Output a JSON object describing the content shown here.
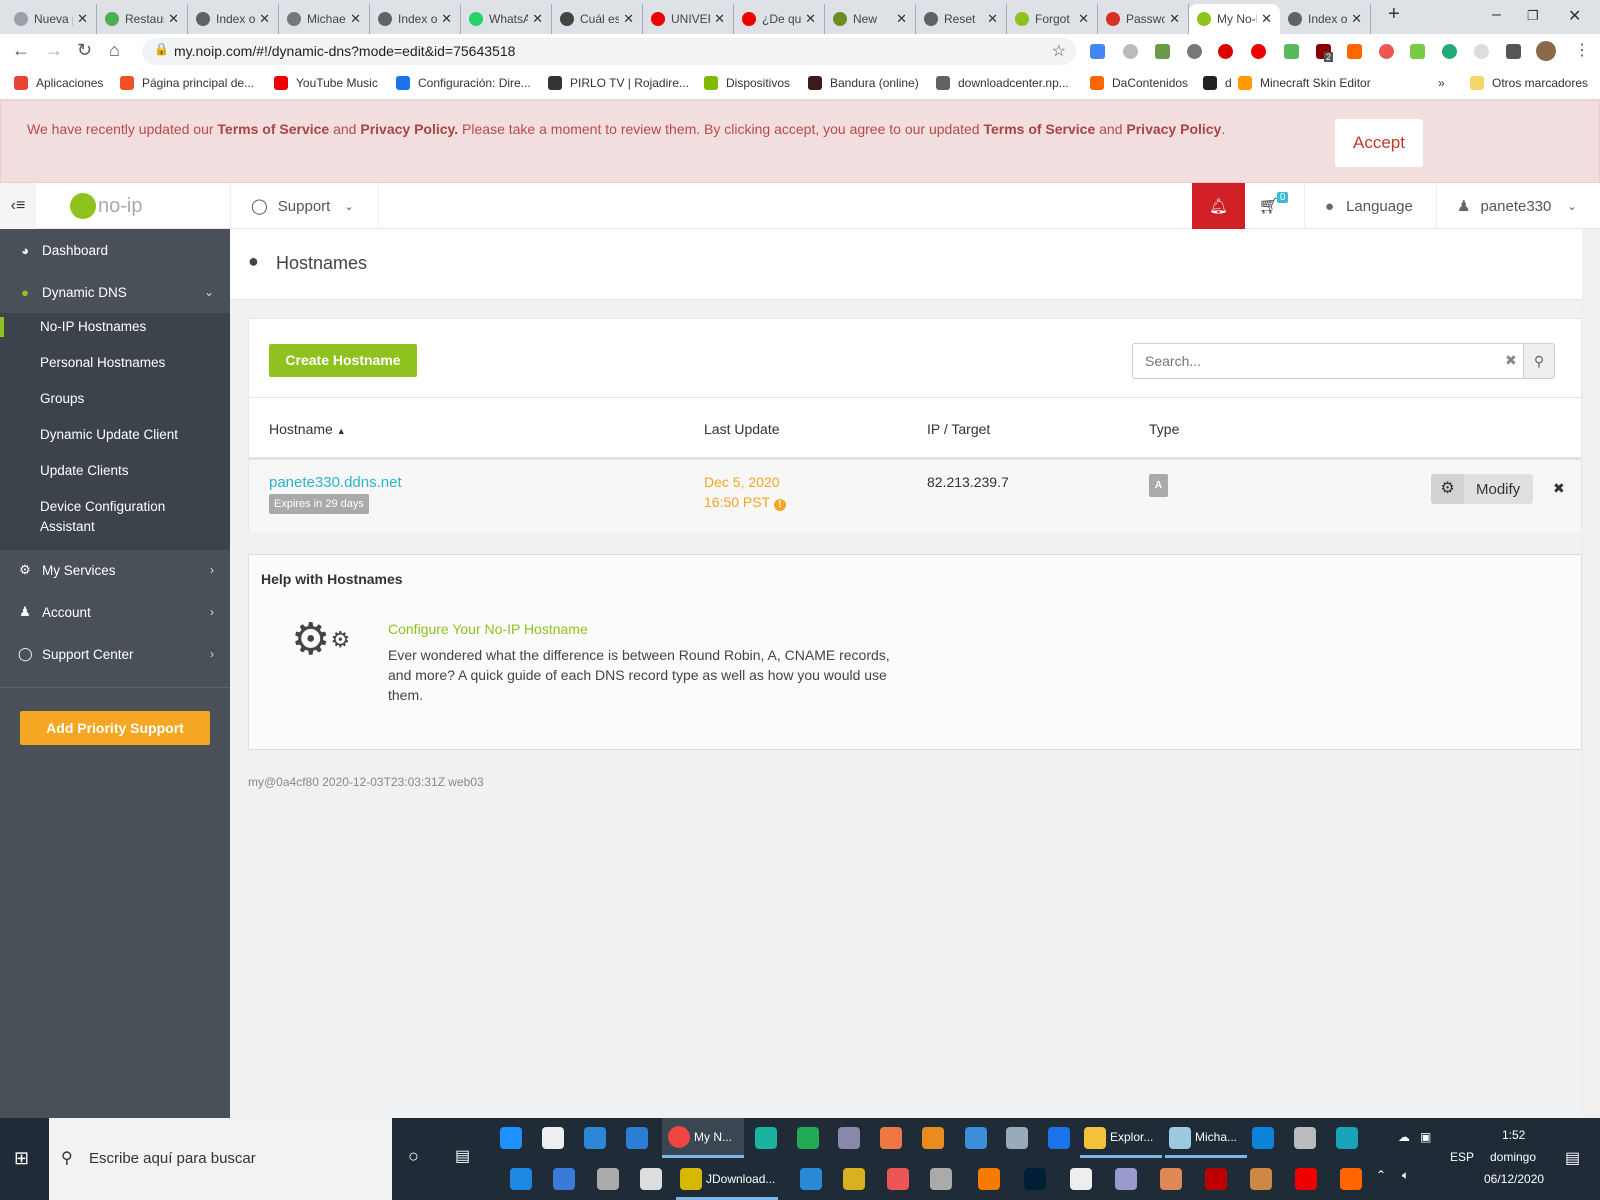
{
  "browser": {
    "tabs": [
      {
        "title": "Nueva pestaña",
        "color": "#9aa0a6"
      },
      {
        "title": "Restaurar",
        "color": "#4caf50"
      },
      {
        "title": "Index of",
        "color": "#5f6368"
      },
      {
        "title": "Michael",
        "color": "#777"
      },
      {
        "title": "Index of",
        "color": "#5f6368"
      },
      {
        "title": "WhatsApp",
        "color": "#25d366"
      },
      {
        "title": "Cuál es mi IP",
        "color": "#444"
      },
      {
        "title": "UNIVERSO",
        "color": "#e00"
      },
      {
        "title": "¿De qué",
        "color": "#e00"
      },
      {
        "title": "New",
        "color": "#6b8e23"
      },
      {
        "title": "Reset",
        "color": "#5f6368"
      },
      {
        "title": "Forgot",
        "color": "#8dc21f"
      },
      {
        "title": "Password",
        "color": "#d93025"
      },
      {
        "title": "My No-IP",
        "color": "#8dc21f"
      },
      {
        "title": "Index of",
        "color": "#5f6368"
      }
    ],
    "active_tab": 13,
    "url": "my.noip.com/#!/dynamic-dns?mode=edit&id=75643518",
    "bookmarks": [
      "Aplicaciones",
      "Página principal de...",
      "YouTube Music",
      "Configuración: Dire...",
      "PIRLO TV | Rojadire...",
      "Dispositivos",
      "Bandura (online)",
      "downloadcenter.np...",
      "DaContenidos",
      "d",
      "Minecraft Skin Editor"
    ],
    "other_bookmarks": "Otros marcadores",
    "ext_badge": "2"
  },
  "banner": {
    "t1": "We have recently updated our ",
    "l1": "Terms of Service",
    "t2": " and ",
    "l2": "Privacy Policy.",
    "t3": " Please take a moment to review them. By clicking accept, you agree to our updated ",
    "l3": "Terms of Service",
    "t4": " and ",
    "l4": "Privacy Policy",
    "t5": ".",
    "accept": "Accept"
  },
  "header": {
    "logo": "no-ip",
    "support": "Support",
    "cart_count": "0",
    "language": "Language",
    "user": "panete330"
  },
  "sidebar": {
    "dashboard": "Dashboard",
    "dynamic_dns": "Dynamic DNS",
    "sub": [
      "No-IP Hostnames",
      "Personal Hostnames",
      "Groups",
      "Dynamic Update Client",
      "Update Clients",
      "Device Configuration Assistant"
    ],
    "my_services": "My Services",
    "account": "Account",
    "support_center": "Support Center",
    "priority": "Add Priority Support"
  },
  "page": {
    "title": "Hostnames"
  },
  "panel": {
    "create": "Create Hostname",
    "search_placeholder": "Search...",
    "columns": [
      "Hostname",
      "Last Update",
      "IP / Target",
      "Type"
    ],
    "row": {
      "hostname": "panete330.ddns.net",
      "expires": "Expires in 29 days",
      "date": "Dec 5, 2020",
      "time": "16:50 PST",
      "ip": "82.213.239.7",
      "type": "A",
      "modify": "Modify"
    }
  },
  "help": {
    "heading": "Help with Hostnames",
    "link": "Configure Your No-IP Hostname",
    "text": "Ever wondered what the difference is between Round Robin, A, CNAME records, and more? A quick guide of each DNS record type as well as how you would use them."
  },
  "footer": "my@0a4cf80 2020-12-03T23:03:31Z web03",
  "taskbar": {
    "search": "Escribe aquí para buscar",
    "chrome": "My N...",
    "jdownloader": "JDownload...",
    "explorer": "Explor...",
    "notepad": "Micha...",
    "lang": "ESP",
    "time": "1:52",
    "day": "domingo",
    "date": "06/12/2020"
  },
  "colors": {
    "green": "#8dc21f",
    "orange": "#f5a623",
    "red": "#d11f26",
    "link": "#2bb5c8"
  }
}
